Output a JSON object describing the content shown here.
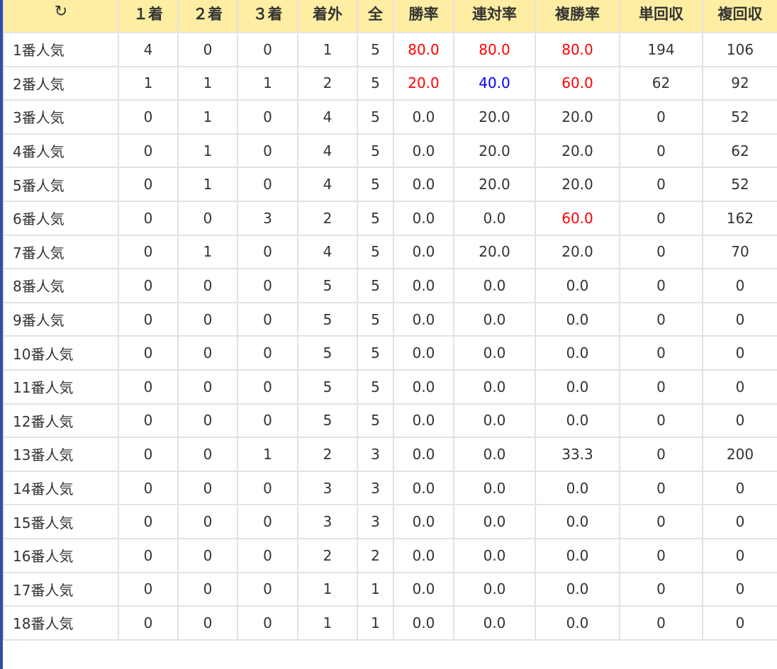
{
  "header": {
    "refresh_icon": "↻",
    "columns": [
      "１着",
      "２着",
      "３着",
      "着外",
      "全",
      "勝率",
      "連対率",
      "複勝率",
      "単回収",
      "複回収"
    ]
  },
  "colors": {
    "header_bg": "#fdeea3",
    "highlight_red": "#ff0000",
    "highlight_blue": "#0000ff",
    "left_accent": "#2f4fa6"
  },
  "rows": [
    {
      "label": "1番人気",
      "values": [
        "4",
        "0",
        "0",
        "1",
        "5",
        "80.0",
        "80.0",
        "80.0",
        "194",
        "106"
      ],
      "styles": [
        "",
        "",
        "",
        "",
        "",
        "red",
        "red",
        "red",
        "",
        ""
      ]
    },
    {
      "label": "2番人気",
      "values": [
        "1",
        "1",
        "1",
        "2",
        "5",
        "20.0",
        "40.0",
        "60.0",
        "62",
        "92"
      ],
      "styles": [
        "",
        "",
        "",
        "",
        "",
        "red",
        "blue",
        "red",
        "",
        ""
      ]
    },
    {
      "label": "3番人気",
      "values": [
        "0",
        "1",
        "0",
        "4",
        "5",
        "0.0",
        "20.0",
        "20.0",
        "0",
        "52"
      ],
      "styles": [
        "",
        "",
        "",
        "",
        "",
        "",
        "",
        "",
        "",
        ""
      ]
    },
    {
      "label": "4番人気",
      "values": [
        "0",
        "1",
        "0",
        "4",
        "5",
        "0.0",
        "20.0",
        "20.0",
        "0",
        "62"
      ],
      "styles": [
        "",
        "",
        "",
        "",
        "",
        "",
        "",
        "",
        "",
        ""
      ]
    },
    {
      "label": "5番人気",
      "values": [
        "0",
        "1",
        "0",
        "4",
        "5",
        "0.0",
        "20.0",
        "20.0",
        "0",
        "52"
      ],
      "styles": [
        "",
        "",
        "",
        "",
        "",
        "",
        "",
        "",
        "",
        ""
      ]
    },
    {
      "label": "6番人気",
      "values": [
        "0",
        "0",
        "3",
        "2",
        "5",
        "0.0",
        "0.0",
        "60.0",
        "0",
        "162"
      ],
      "styles": [
        "",
        "",
        "",
        "",
        "",
        "",
        "",
        "red",
        "",
        ""
      ]
    },
    {
      "label": "7番人気",
      "values": [
        "0",
        "1",
        "0",
        "4",
        "5",
        "0.0",
        "20.0",
        "20.0",
        "0",
        "70"
      ],
      "styles": [
        "",
        "",
        "",
        "",
        "",
        "",
        "",
        "",
        "",
        ""
      ]
    },
    {
      "label": "8番人気",
      "values": [
        "0",
        "0",
        "0",
        "5",
        "5",
        "0.0",
        "0.0",
        "0.0",
        "0",
        "0"
      ],
      "styles": [
        "",
        "",
        "",
        "",
        "",
        "",
        "",
        "",
        "",
        ""
      ]
    },
    {
      "label": "9番人気",
      "values": [
        "0",
        "0",
        "0",
        "5",
        "5",
        "0.0",
        "0.0",
        "0.0",
        "0",
        "0"
      ],
      "styles": [
        "",
        "",
        "",
        "",
        "",
        "",
        "",
        "",
        "",
        ""
      ]
    },
    {
      "label": "10番人気",
      "values": [
        "0",
        "0",
        "0",
        "5",
        "5",
        "0.0",
        "0.0",
        "0.0",
        "0",
        "0"
      ],
      "styles": [
        "",
        "",
        "",
        "",
        "",
        "",
        "",
        "",
        "",
        ""
      ]
    },
    {
      "label": "11番人気",
      "values": [
        "0",
        "0",
        "0",
        "5",
        "5",
        "0.0",
        "0.0",
        "0.0",
        "0",
        "0"
      ],
      "styles": [
        "",
        "",
        "",
        "",
        "",
        "",
        "",
        "",
        "",
        ""
      ]
    },
    {
      "label": "12番人気",
      "values": [
        "0",
        "0",
        "0",
        "5",
        "5",
        "0.0",
        "0.0",
        "0.0",
        "0",
        "0"
      ],
      "styles": [
        "",
        "",
        "",
        "",
        "",
        "",
        "",
        "",
        "",
        ""
      ]
    },
    {
      "label": "13番人気",
      "values": [
        "0",
        "0",
        "1",
        "2",
        "3",
        "0.0",
        "0.0",
        "33.3",
        "0",
        "200"
      ],
      "styles": [
        "",
        "",
        "",
        "",
        "",
        "",
        "",
        "",
        "",
        ""
      ]
    },
    {
      "label": "14番人気",
      "values": [
        "0",
        "0",
        "0",
        "3",
        "3",
        "0.0",
        "0.0",
        "0.0",
        "0",
        "0"
      ],
      "styles": [
        "",
        "",
        "",
        "",
        "",
        "",
        "",
        "",
        "",
        ""
      ]
    },
    {
      "label": "15番人気",
      "values": [
        "0",
        "0",
        "0",
        "3",
        "3",
        "0.0",
        "0.0",
        "0.0",
        "0",
        "0"
      ],
      "styles": [
        "",
        "",
        "",
        "",
        "",
        "",
        "",
        "",
        "",
        ""
      ]
    },
    {
      "label": "16番人気",
      "values": [
        "0",
        "0",
        "0",
        "2",
        "2",
        "0.0",
        "0.0",
        "0.0",
        "0",
        "0"
      ],
      "styles": [
        "",
        "",
        "",
        "",
        "",
        "",
        "",
        "",
        "",
        ""
      ]
    },
    {
      "label": "17番人気",
      "values": [
        "0",
        "0",
        "0",
        "1",
        "1",
        "0.0",
        "0.0",
        "0.0",
        "0",
        "0"
      ],
      "styles": [
        "",
        "",
        "",
        "",
        "",
        "",
        "",
        "",
        "",
        ""
      ]
    },
    {
      "label": "18番人気",
      "values": [
        "0",
        "0",
        "0",
        "1",
        "1",
        "0.0",
        "0.0",
        "0.0",
        "0",
        "0"
      ],
      "styles": [
        "",
        "",
        "",
        "",
        "",
        "",
        "",
        "",
        "",
        ""
      ]
    }
  ]
}
